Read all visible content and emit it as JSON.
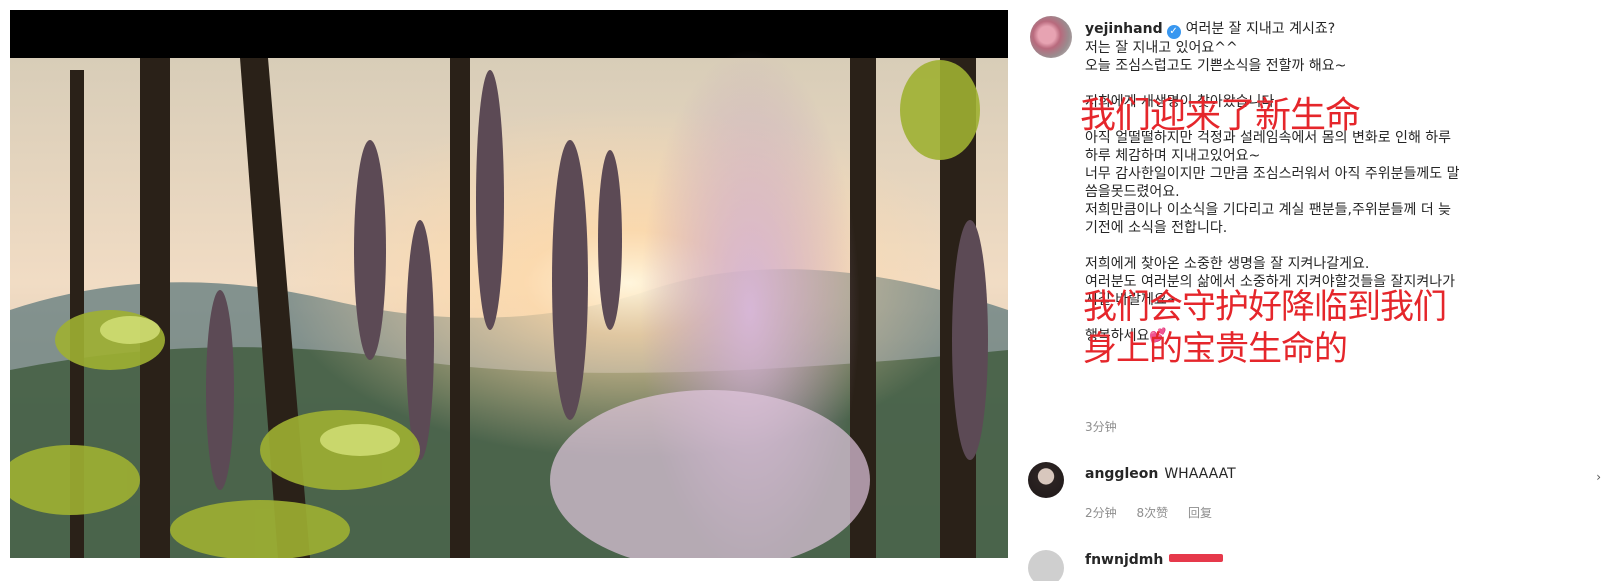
{
  "post": {
    "username": "yejinhand",
    "verified": true,
    "caption_lines": [
      "여러분 잘 지내고 계시죠?",
      "저는 잘 지내고 있어요^^",
      "오늘 조심스럽고도 기쁜소식을 전할까 해요~",
      "",
      "저희에게 새생명이 찾아왔습니다.",
      "",
      "아직 얼떨떨하지만 걱정과 설레임속에서 몸의 변화로 인해 하루",
      "하루 체감하며 지내고있어요~",
      "너무 감사한일이지만 그만큼 조심스러워서 아직 주위분들께도 말",
      "씀을못드렸어요.",
      "저희만큼이나 이소식을 기다리고 계실 팬분들,주위분들께 더 늦",
      "기전에 소식을 전합니다.",
      "",
      "저희에게 찾아온 소중한 생명을 잘 지켜나갈게요.",
      "여러분도 여러분의 삶에서 소중하게 지켜야할것들을 잘지켜나가",
      "시길 바랄께요~",
      "",
      "행복하세요"
    ],
    "closing_emoji": "💕",
    "time": "3分钟"
  },
  "comments": [
    {
      "username": "anggleon",
      "text": "WHAAAAT",
      "time": "2分钟",
      "likes": "8次赞",
      "reply_label": "回复"
    }
  ],
  "next_comment_username": "fnwnjdmh",
  "overlay_text": {
    "line1": "我们迎来了新生命",
    "line2": "我们会守护好降临到我们",
    "line3": "身上的宝贵生命的"
  },
  "colors": {
    "overlay_red": "#e5262b",
    "verified_blue": "#3897f0",
    "meta_gray": "#8e8e8e"
  },
  "icons": {
    "verified": "verified-badge-icon",
    "heart": "two-hearts-icon"
  }
}
